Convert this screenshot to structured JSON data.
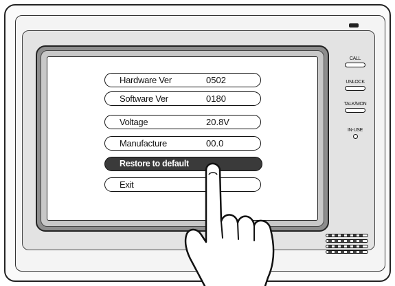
{
  "menu": {
    "items": [
      {
        "label": "Hardware Ver",
        "value": "0502"
      },
      {
        "label": "Software Ver",
        "value": "0180"
      },
      {
        "label": "Voltage",
        "value": "20.8V"
      },
      {
        "label": "Manufacture",
        "value": "00.0"
      },
      {
        "label": "Restore to default",
        "value": "",
        "selected": true
      },
      {
        "label": "Exit",
        "value": ""
      }
    ]
  },
  "side_buttons": {
    "call": "CALL",
    "unlock": "UNLOCK",
    "talk_mon": "TALK/MON",
    "in_use": "IN-USE"
  },
  "colors": {
    "selected_bg": "#3a3a3a",
    "bezel": "#8d8d8d",
    "device_panel": "#e3e3e3"
  },
  "icons": [
    "power-indicator-icon",
    "in-use-led-icon",
    "speaker-grille-icon",
    "pointing-hand-icon"
  ]
}
